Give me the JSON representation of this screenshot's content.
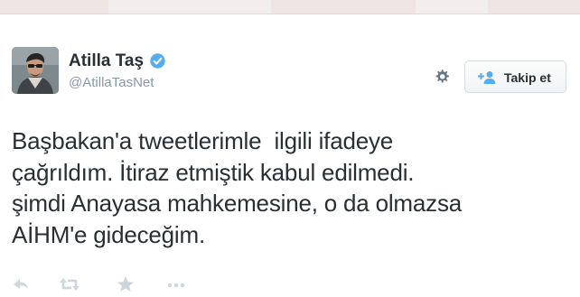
{
  "user": {
    "display_name": "Atilla Taş",
    "handle": "@AtillaTasNet",
    "verified_icon": "verified-badge-icon"
  },
  "header": {
    "settings_icon": "gear-icon",
    "follow_icon": "add-user-icon",
    "follow_label": "Takip et"
  },
  "tweet": {
    "lines": [
      "Başbakan'a tweetlerimle  ilgili ifadeye",
      "çağrıldım. İtiraz etmiştik kabul edilmedi.",
      "şimdi Anayasa mahkemesine, o da olmazsa",
      "AİHM'e gideceğim."
    ]
  },
  "actions": [
    {
      "name": "reply-icon"
    },
    {
      "name": "retweet-icon"
    },
    {
      "name": "favorite-star-icon"
    },
    {
      "name": "more-icon"
    }
  ],
  "colors": {
    "text": "#292f33",
    "muted": "#8899a6",
    "verified": "#55acee",
    "icons_muted": "#ccd6dd",
    "follow_icon": "#55acee"
  }
}
